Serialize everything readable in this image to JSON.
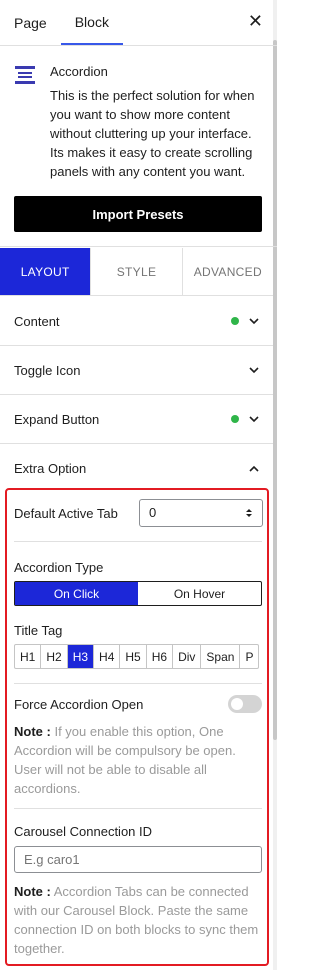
{
  "top_tabs": {
    "page": "Page",
    "block": "Block",
    "close_icon": "close-icon"
  },
  "block": {
    "name": "Accordion",
    "description": "This is the perfect solution for when you want to show more content without cluttering up your interface. Its makes it easy to create scrolling panels with any content you want.",
    "icon": "accordion-icon",
    "import_button": "Import Presets"
  },
  "main_tabs": [
    "LAYOUT",
    "STYLE",
    "ADVANCED"
  ],
  "panels": [
    {
      "label": "Content",
      "status_dot": true
    },
    {
      "label": "Toggle Icon",
      "status_dot": false
    },
    {
      "label": "Expand Button",
      "status_dot": true
    },
    {
      "label": "Extra Option",
      "status_dot": false
    }
  ],
  "extra_option": {
    "default_active_tab_label": "Default Active Tab",
    "default_active_tab_value": "0",
    "accordion_type_label": "Accordion Type",
    "accordion_type_options": [
      "On Click",
      "On Hover"
    ],
    "accordion_type_selected": "On Click",
    "title_tag_label": "Title Tag",
    "title_tags": [
      "H1",
      "H2",
      "H3",
      "H4",
      "H5",
      "H6",
      "Div",
      "Span",
      "P"
    ],
    "title_tag_selected": "H3",
    "force_open_label": "Force Accordion Open",
    "force_open_enabled": false,
    "force_open_note_prefix": "Note :",
    "force_open_note": " If you enable this option, One Accordion will be compulsory be open. User will not be able to disable all accordions.",
    "carousel_id_label": "Carousel Connection ID",
    "carousel_id_placeholder": "E.g caro1",
    "carousel_note_prefix": "Note :",
    "carousel_note": " Accordion Tabs can be connected with our Carousel Block. Paste the same connection ID on both blocks to sync them together."
  },
  "colors": {
    "accent": "#1c27d8",
    "highlight_border": "#e31b23",
    "status_dot": "#2fb549"
  }
}
